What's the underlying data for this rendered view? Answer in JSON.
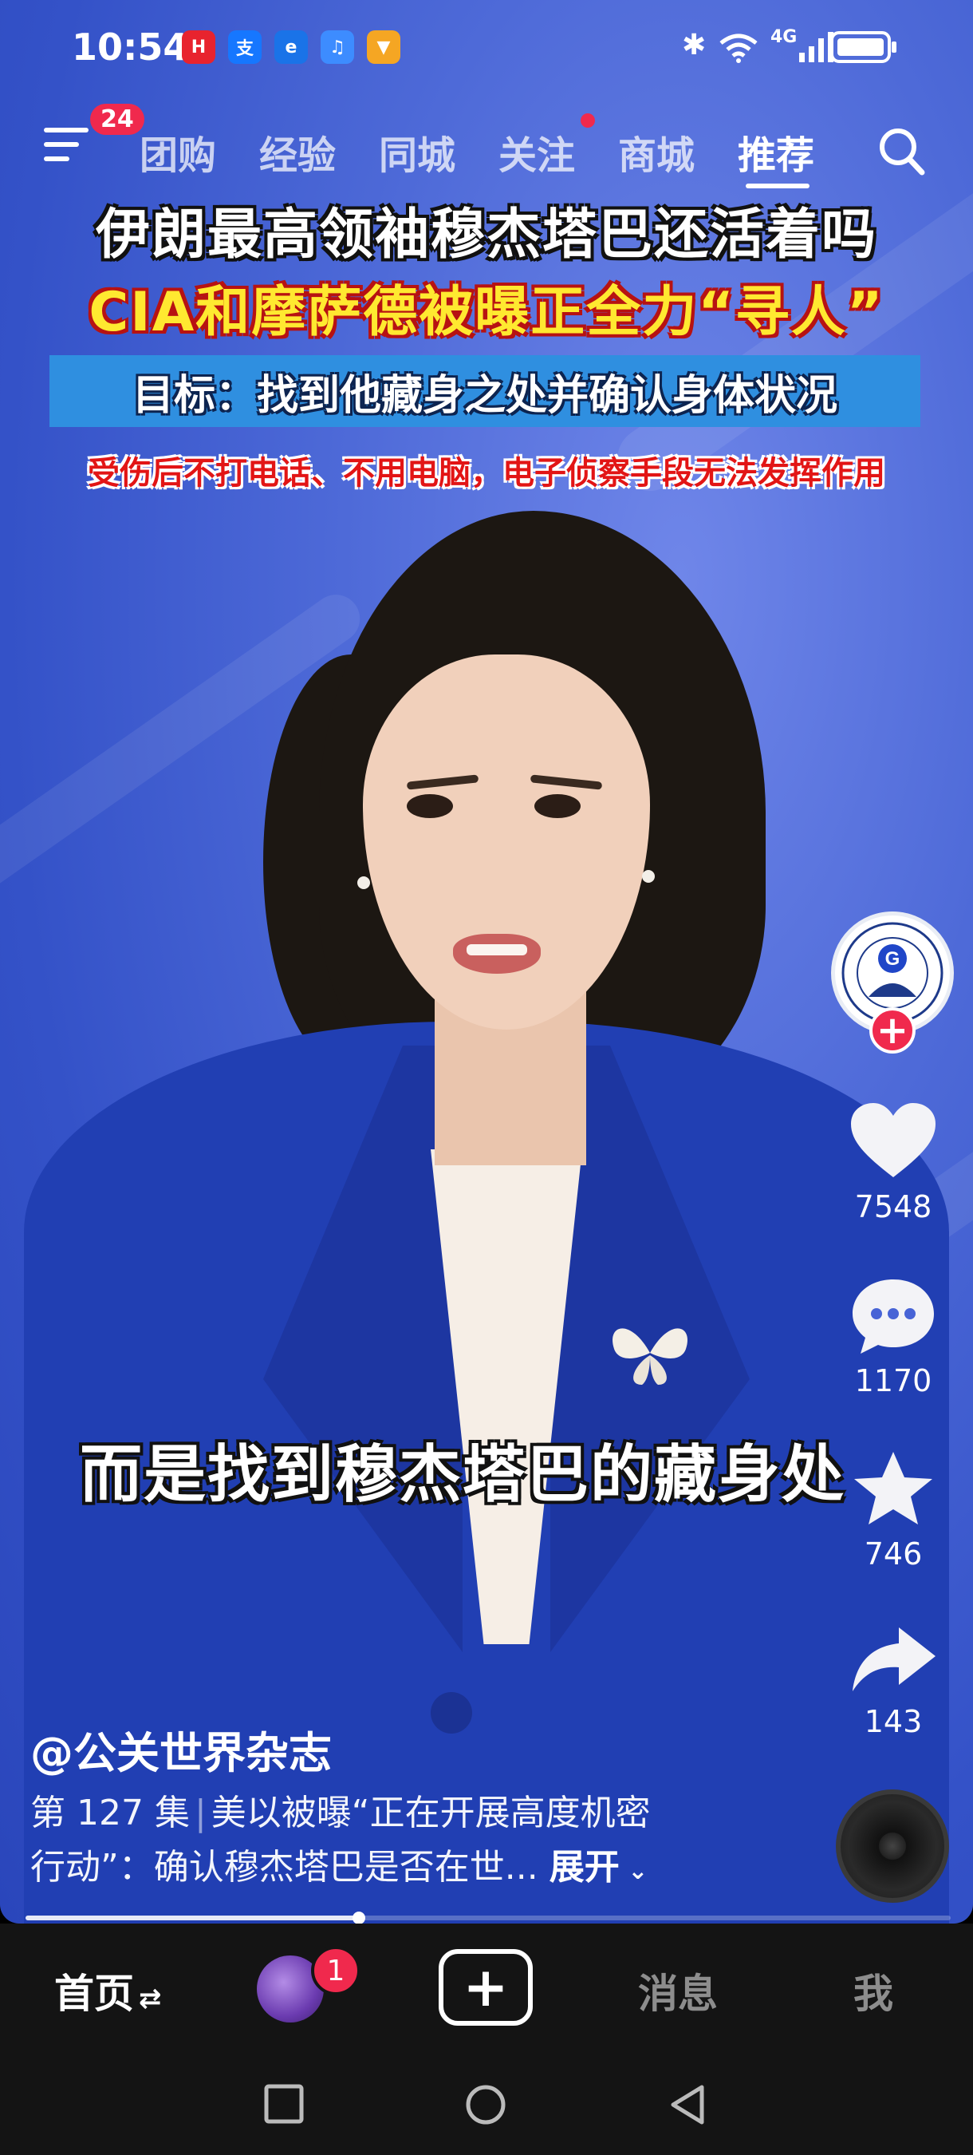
{
  "status_bar": {
    "time": "10:54",
    "app_icons": [
      {
        "name": "huawei-icon",
        "color": "#e8232e"
      },
      {
        "name": "alipay-icon",
        "color": "#1677ff"
      },
      {
        "name": "browser-icon",
        "color": "#1a73e8"
      },
      {
        "name": "music-icon",
        "color": "#3d8cff"
      },
      {
        "name": "paint-icon",
        "color": "#f5a623"
      }
    ],
    "network": "4G"
  },
  "top_nav": {
    "menu_badge": "24",
    "tabs": [
      {
        "label": "团购"
      },
      {
        "label": "经验"
      },
      {
        "label": "同城"
      },
      {
        "label": "关注"
      },
      {
        "label": "商城"
      },
      {
        "label": "推荐",
        "active": true
      }
    ]
  },
  "video": {
    "headline1": "伊朗最高领袖穆杰塔巴还活着吗",
    "headline2": "CIA和摩萨德被曝正全力“寻人”",
    "target": "目标：找到他藏身之处并确认身体状况",
    "subline": "受伤后不打电话、不用电脑，电子侦察手段无法发挥作用",
    "caption": "而是找到穆杰塔巴的藏身处",
    "progress": 0.36
  },
  "actions": {
    "likes": "7548",
    "comments": "1170",
    "favorites": "746",
    "shares": "143"
  },
  "post": {
    "author": "@公关世界杂志",
    "episode": "第 127 集",
    "description_line1": "美以被曝“正在开展高度机密",
    "description_line2": "行动”：确认穆杰塔巴是否在世...",
    "expand_label": "展开"
  },
  "bottom_nav": {
    "home": "首页",
    "friends_badge": "1",
    "create": "+",
    "messages": "消息",
    "me": "我"
  }
}
